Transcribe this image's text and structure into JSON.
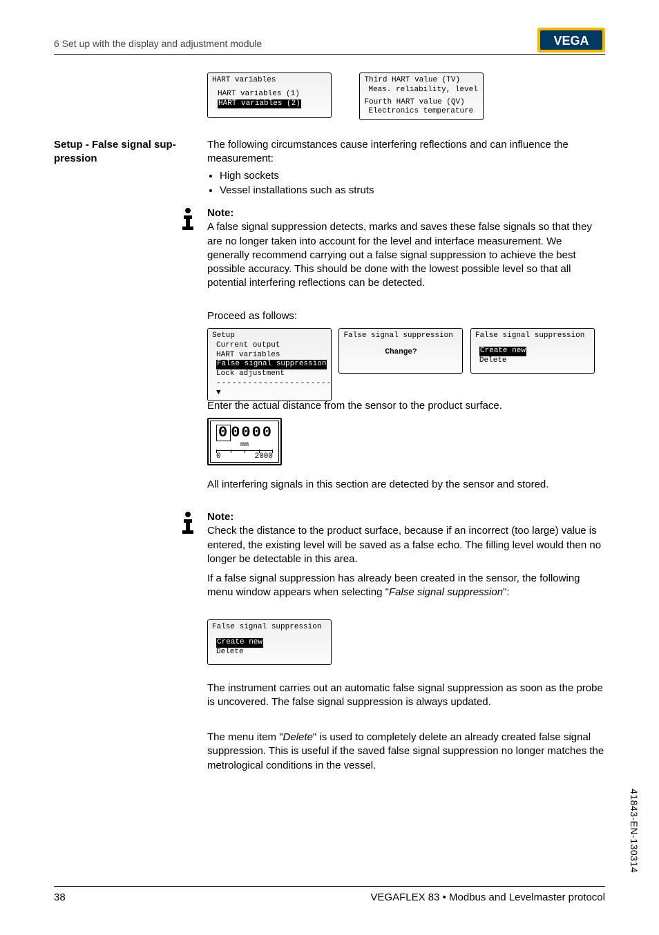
{
  "header": {
    "section": "6 Set up with the display and adjustment module"
  },
  "side_heading": {
    "title": "Setup - False signal sup-",
    "title2": "pression"
  },
  "lcd_top": {
    "left": {
      "title": "HART variables",
      "row1": "HART variables (1)",
      "row2_hl": "HART variables (2)"
    },
    "right": {
      "row1": "Third HART value (TV)",
      "row2": "Meas. reliability, level",
      "row3": "Fourth HART value (QV)",
      "row4": "Electronics temperature"
    }
  },
  "para": {
    "intro": "The following circumstances cause interfering reflections and can influence the measurement:",
    "b1": "High sockets",
    "b2": "Vessel installations such as struts"
  },
  "note1": {
    "label": "Note:",
    "text": "A false signal suppression detects, marks and saves these false signals so that they are no longer taken into account for the level and interface measurement. We generally recommend carrying out a false signal suppression to achieve the best possible accuracy. This should be done with the lowest possible level so that all potential interfering reflections can be detected."
  },
  "proceed": "Proceed as follows:",
  "lcd_mid": {
    "left": {
      "title": "Setup",
      "r1": "Current output",
      "r2": "HART variables",
      "r3_hl": "False signal suppression",
      "r4": "Lock adjustment",
      "dashes": "----------------------",
      "arrow": "▼"
    },
    "center": {
      "title": "False signal suppression",
      "line": "Change?"
    },
    "right": {
      "title": "False signal suppression",
      "opt1_hl": "Create new",
      "opt2": "Delete"
    }
  },
  "enter_line": "Enter the actual distance from the sensor to the product surface.",
  "digit_lcd": {
    "digits": "00000",
    "unit": "mm",
    "left": "0",
    "right": "2000"
  },
  "stored_line": "All interfering signals in this section are detected by the sensor and stored.",
  "note2": {
    "label": "Note:",
    "text": "Check the distance to the product surface, because if an incorrect (too large) value is entered, the existing level will be saved as a false echo. The filling level would then no longer be detectable in this area."
  },
  "para_after": {
    "p1a": "If a false signal suppression has already been created in the sensor, the following menu window appears when selecting \"",
    "p1b": "False signal suppression",
    "p1c": "\":"
  },
  "lcd_bottom": {
    "title": "False signal suppression",
    "opt1_hl": "Create new",
    "opt2": "Delete"
  },
  "para_tail": {
    "t1": "The instrument carries out an automatic false signal suppression as soon as the probe is uncovered. The false signal suppression is always updated.",
    "t2a": "The menu item \"",
    "t2b": "Delete",
    "t2c": "\" is used to completely delete an already created false signal suppression. This is useful if the saved false signal suppression no longer matches the metrological conditions in the vessel."
  },
  "footer": {
    "page": "38",
    "product": "VEGAFLEX 83 • Modbus and Levelmaster protocol",
    "code": "41843-EN-130314"
  }
}
